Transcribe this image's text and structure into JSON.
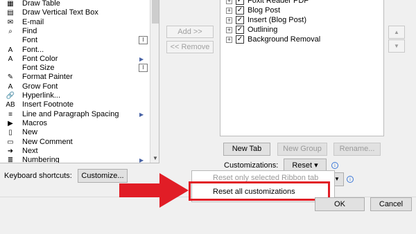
{
  "commands": [
    {
      "label": "Draw Table",
      "icon": "draw-table-icon",
      "glyph": "▦",
      "extra": ""
    },
    {
      "label": "Draw Vertical Text Box",
      "icon": "text-box-icon",
      "glyph": "▤",
      "extra": ""
    },
    {
      "label": "E-mail",
      "icon": "email-icon",
      "glyph": "✉",
      "extra": ""
    },
    {
      "label": "Find",
      "icon": "find-icon",
      "glyph": "⌕",
      "extra": ""
    },
    {
      "label": "Font",
      "icon": "",
      "glyph": "",
      "extra": "field"
    },
    {
      "label": "Font...",
      "icon": "font-icon",
      "glyph": "A",
      "extra": ""
    },
    {
      "label": "Font Color",
      "icon": "font-color-icon",
      "glyph": "A",
      "extra": "sub"
    },
    {
      "label": "Font Size",
      "icon": "",
      "glyph": "",
      "extra": "field"
    },
    {
      "label": "Format Painter",
      "icon": "format-painter-icon",
      "glyph": "✎",
      "extra": ""
    },
    {
      "label": "Grow Font",
      "icon": "grow-font-icon",
      "glyph": "A",
      "extra": ""
    },
    {
      "label": "Hyperlink...",
      "icon": "hyperlink-icon",
      "glyph": "🔗",
      "extra": ""
    },
    {
      "label": "Insert Footnote",
      "icon": "footnote-icon",
      "glyph": "AB",
      "extra": ""
    },
    {
      "label": "Line and Paragraph Spacing",
      "icon": "line-spacing-icon",
      "glyph": "≡",
      "extra": "sub"
    },
    {
      "label": "Macros",
      "icon": "macros-icon",
      "glyph": "▶",
      "extra": ""
    },
    {
      "label": "New",
      "icon": "new-doc-icon",
      "glyph": "▯",
      "extra": ""
    },
    {
      "label": "New Comment",
      "icon": "new-comment-icon",
      "glyph": "▭",
      "extra": ""
    },
    {
      "label": "Next",
      "icon": "next-icon",
      "glyph": "➜",
      "extra": ""
    },
    {
      "label": "Numbering",
      "icon": "numbering-icon",
      "glyph": "≣",
      "extra": "sub"
    }
  ],
  "field_glyph": "I",
  "sub_glyph": "▶",
  "middle_buttons": {
    "add": "Add >>",
    "remove": "<< Remove"
  },
  "tree": [
    {
      "label": "Foxit Reader PDF",
      "checked": true
    },
    {
      "label": "Blog Post",
      "checked": true
    },
    {
      "label": "Insert (Blog Post)",
      "checked": true
    },
    {
      "label": "Outlining",
      "checked": true
    },
    {
      "label": "Background Removal",
      "checked": true
    }
  ],
  "tree_plus": "+",
  "check_glyph": "✓",
  "arrows": {
    "up": "▲",
    "down": "▼"
  },
  "tree_buttons": {
    "new_tab": "New Tab",
    "new_group": "New Group",
    "rename": "Rename..."
  },
  "customizations": {
    "label": "Customizations:",
    "reset": "Reset ▾"
  },
  "keyboard": {
    "label": "Keyboard shortcuts:",
    "button": "Customize..."
  },
  "menu": {
    "item1": "Reset only selected Ribbon tab",
    "item2": "Reset all customizations"
  },
  "footer": {
    "ok": "OK",
    "cancel": "Cancel"
  },
  "info_glyph": "i",
  "colors": {
    "highlight": "#e11d26",
    "arrow": "#e11d26"
  }
}
